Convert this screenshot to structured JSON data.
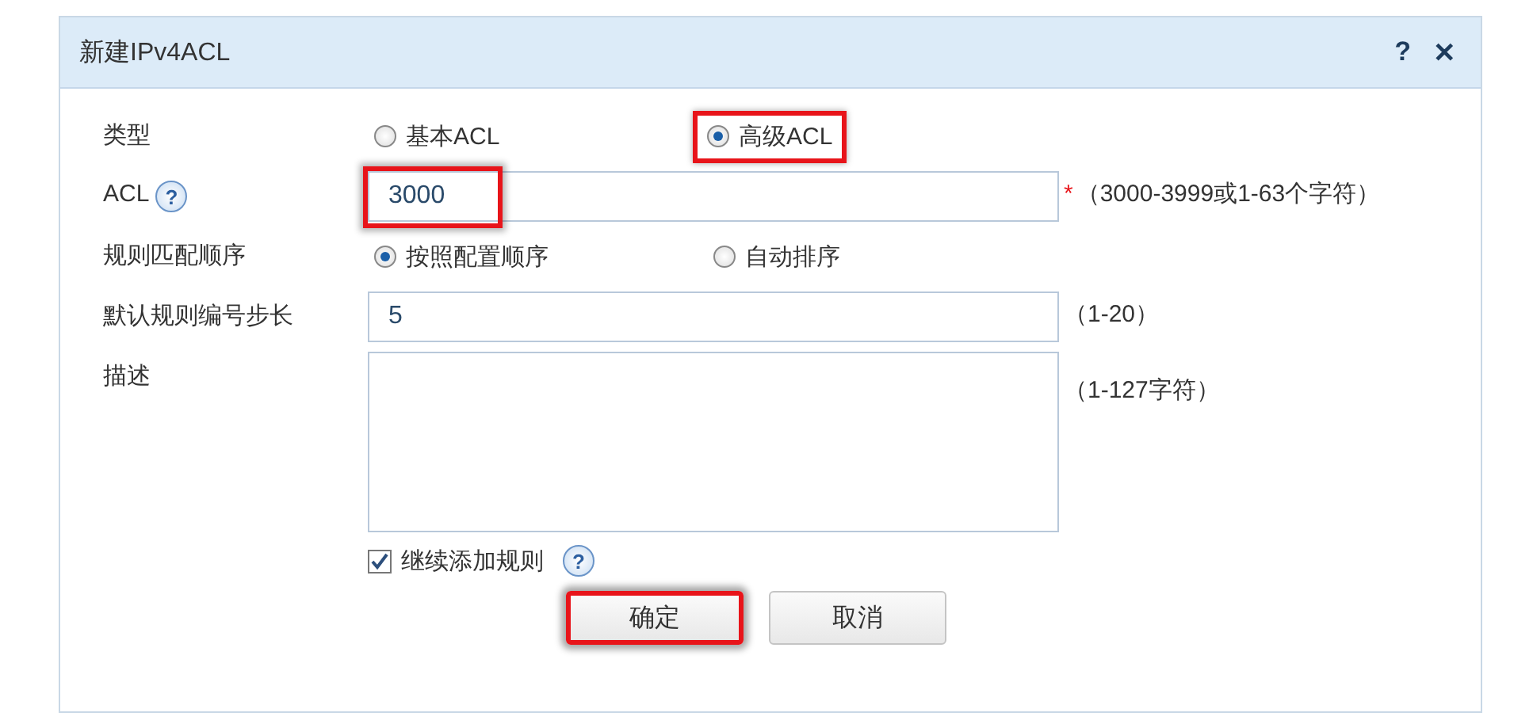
{
  "dialog": {
    "title": "新建IPv4ACL",
    "help_button": "?",
    "close_button": "✕"
  },
  "fields": [
    {
      "kind": "radio",
      "label": "类型",
      "options": [
        {
          "label": "基本ACL",
          "selected": false
        },
        {
          "label": "高级ACL",
          "selected": true,
          "highlighted": true
        }
      ]
    },
    {
      "kind": "text",
      "label": "ACL",
      "help": "?",
      "value": "3000",
      "required_mark": "*",
      "hint": "（3000-3999或1-63个字符）",
      "highlighted": true
    },
    {
      "kind": "radio",
      "label": "规则匹配顺序",
      "options": [
        {
          "label": "按照配置顺序",
          "selected": true
        },
        {
          "label": "自动排序",
          "selected": false
        }
      ]
    },
    {
      "kind": "text",
      "label": "默认规则编号步长",
      "value": "5",
      "hint": "（1-20）"
    },
    {
      "kind": "textarea",
      "label": "描述",
      "hint": "（1-127字符）"
    }
  ],
  "continue_checkbox": {
    "label": "继续添加规则",
    "checked": true,
    "help": "?"
  },
  "buttons": [
    {
      "label": "确定",
      "highlighted": true
    },
    {
      "label": "取消",
      "highlighted": false
    }
  ]
}
